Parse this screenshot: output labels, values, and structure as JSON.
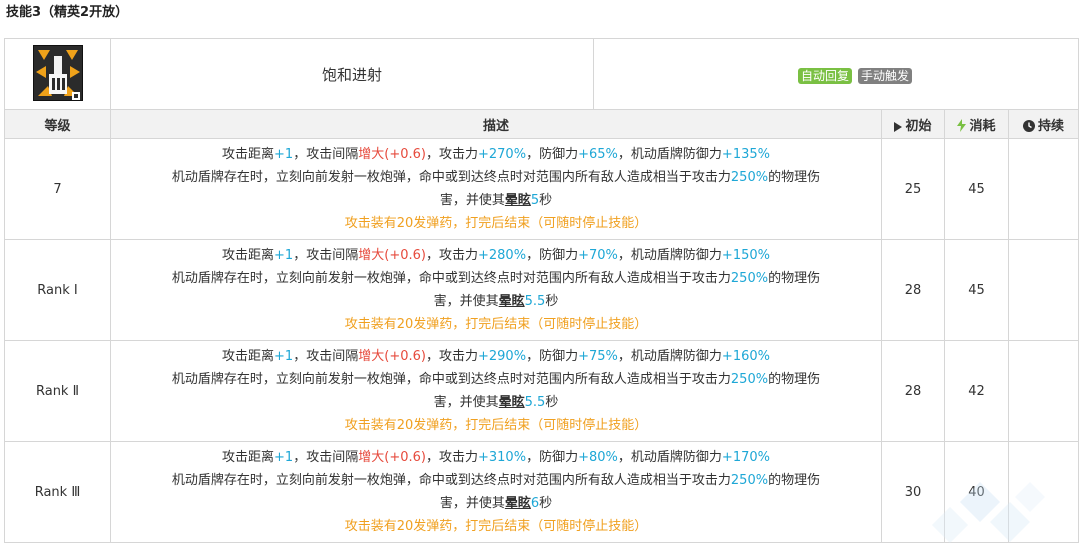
{
  "section_title": "技能3（精英2开放）",
  "skill": {
    "name": "饱和进射",
    "tags": {
      "auto": "自动回复",
      "manual": "手动触发"
    }
  },
  "headers": {
    "level": "等级",
    "desc": "描述",
    "init": "初始",
    "cost": "消耗",
    "duration": "持续"
  },
  "colors": {
    "blue": "#1ea7d6",
    "red": "#e64a3c",
    "orange": "#f0a020",
    "auto_tag": "#7ac043",
    "manual_tag": "#808080"
  },
  "common": {
    "range_label": "攻击距离",
    "range_value": "+1",
    "interval_label": "攻击间隔",
    "interval_word": "增大",
    "interval_value": "(+0.6)",
    "atk_label": "攻击力",
    "def_label": "防御力",
    "shield_label": "机动盾牌防御力",
    "line2_prefix": "机动盾牌存在时，立刻向前发射一枚炮弹，命中或到达终点时对范围内所有敌人造成相当于攻击力",
    "dmg_pct": "250%",
    "line2_suffix": "的物理伤",
    "line3_prefix": "害，并使其",
    "stun_word": "晕眩",
    "seconds_unit": "秒",
    "line4": "攻击装有20发弹药，打完后结束（可随时停止技能）"
  },
  "rows": [
    {
      "level": "7",
      "atk": "+270%",
      "def": "+65%",
      "shield": "+135%",
      "stun": "5",
      "init": "25",
      "cost": "45",
      "duration": ""
    },
    {
      "level": "Rank Ⅰ",
      "atk": "+280%",
      "def": "+70%",
      "shield": "+150%",
      "stun": "5.5",
      "init": "28",
      "cost": "45",
      "duration": ""
    },
    {
      "level": "Rank Ⅱ",
      "atk": "+290%",
      "def": "+75%",
      "shield": "+160%",
      "stun": "5.5",
      "init": "28",
      "cost": "42",
      "duration": ""
    },
    {
      "level": "Rank Ⅲ",
      "atk": "+310%",
      "def": "+80%",
      "shield": "+170%",
      "stun": "6",
      "init": "30",
      "cost": "40",
      "duration": ""
    }
  ]
}
